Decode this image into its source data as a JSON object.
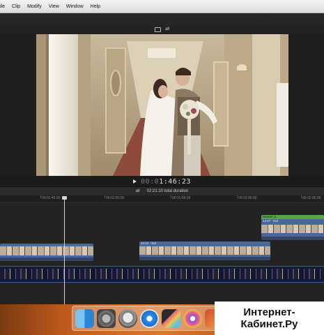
{
  "menu": {
    "items": [
      "ile",
      "Clip",
      "Modify",
      "View",
      "Window",
      "Help"
    ]
  },
  "viewer": {
    "label": "all"
  },
  "timecode": {
    "dim": "00:0",
    "value": "1:46:23"
  },
  "timeline": {
    "index_label": "all",
    "duration_label": "02:21:10 total duration",
    "ruler_ticks": [
      "00:01:45:00",
      "00:01:50:00",
      "00:01:55:00",
      "00:02:00:00",
      "00:02:05:00"
    ]
  },
  "clips": {
    "upper_clip_label": "14:07 - Nol",
    "upper_clip_header": "Neutral (1",
    "middle_clip_label": "14:22 - Nol"
  },
  "watermark": {
    "line1": "Интернет-",
    "line2": "Кабинет.Ру"
  },
  "colors": {
    "upper_clip_header": "#5aa34a",
    "storyline": "#0f1b3c",
    "clip_blue": "#4a6797",
    "dock_backdrop": "#c05a1c"
  },
  "dock": {
    "icons": [
      "finder-icon",
      "system-preferences-icon",
      "launchpad-icon",
      "safari-icon",
      "final-cut-pro-icon",
      "motion-icon",
      "photo-app-icon"
    ]
  }
}
